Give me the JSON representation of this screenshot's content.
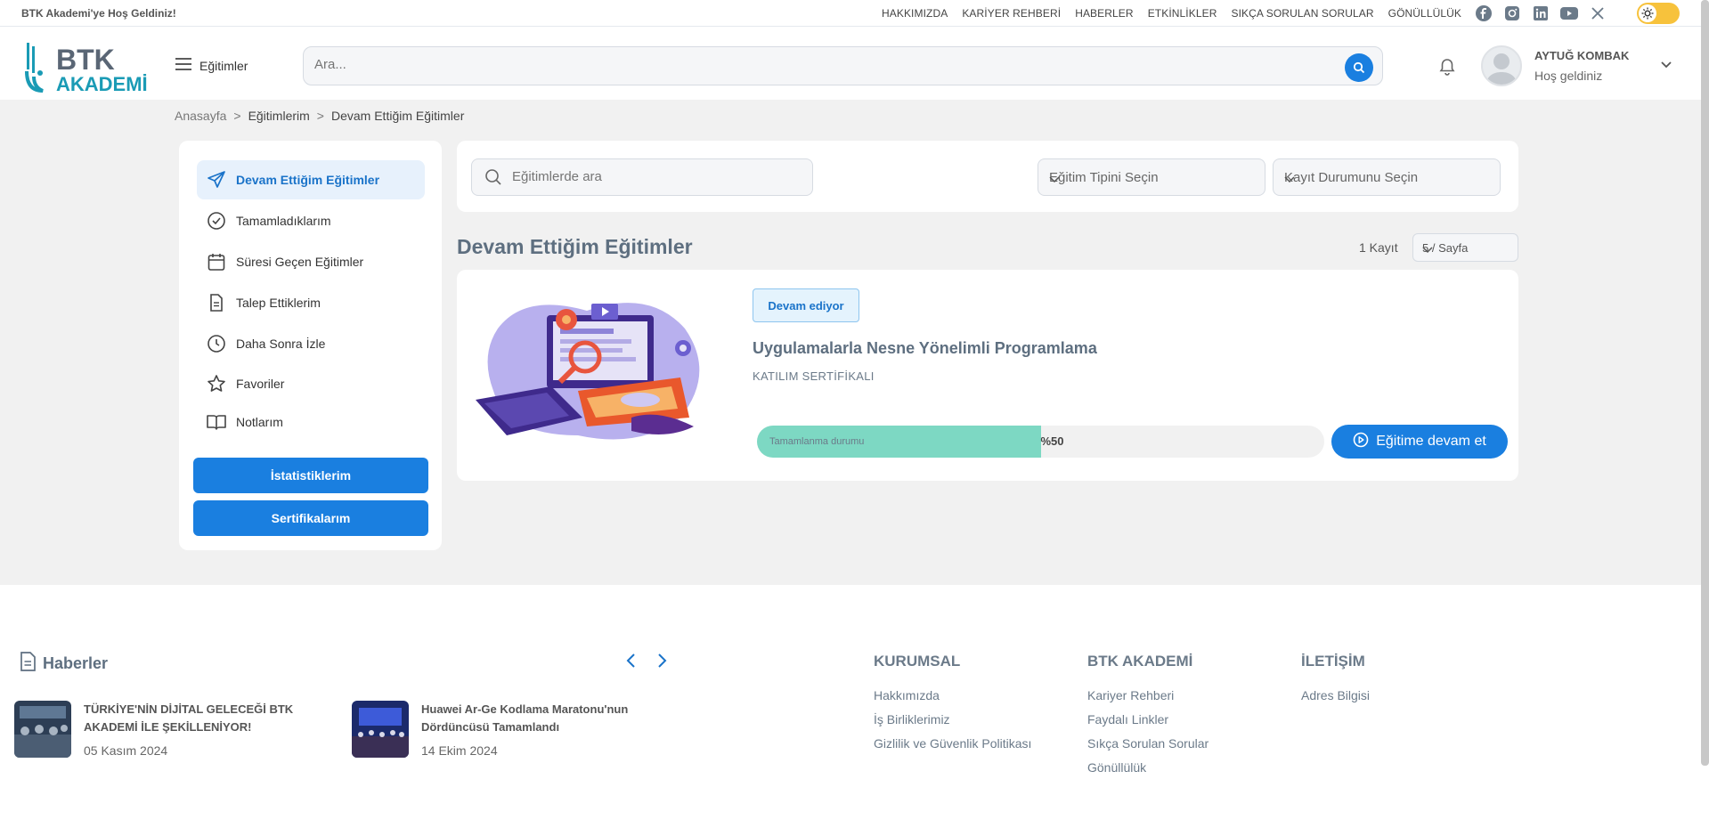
{
  "topbar": {
    "welcome": "BTK Akademi'ye Hoş Geldiniz!",
    "nav": [
      "HAKKIMIZDA",
      "KARİYER REHBERİ",
      "HABERLER",
      "ETKİNLİKLER",
      "SIKÇA SORULAN SORULAR",
      "GÖNÜLLÜLÜK"
    ],
    "socials": [
      "facebook-icon",
      "instagram-icon",
      "linkedin-icon",
      "youtube-icon",
      "x-icon"
    ]
  },
  "header": {
    "logo_top": "BTK",
    "logo_bottom": "AKADEMİ",
    "menu_label": "Eğitimler",
    "search_placeholder": "Ara...",
    "user_name": "AYTUĞ KOMBAK",
    "user_greeting": "Hoş geldiniz"
  },
  "breadcrumb": {
    "items": [
      "Anasayfa",
      "Eğitimlerim",
      "Devam Ettiğim Eğitimler"
    ],
    "separator": ">"
  },
  "sidebar": {
    "items": [
      {
        "label": "Devam Ettiğim Eğitimler",
        "icon": "send-icon",
        "active": true
      },
      {
        "label": "Tamamladıklarım",
        "icon": "check-circle-icon"
      },
      {
        "label": "Süresi Geçen Eğitimler",
        "icon": "calendar-icon"
      },
      {
        "label": "Talep Ettiklerim",
        "icon": "document-icon"
      },
      {
        "label": "Daha Sonra İzle",
        "icon": "clock-icon"
      },
      {
        "label": "Favoriler",
        "icon": "star-icon"
      },
      {
        "label": "Notlarım",
        "icon": "book-icon"
      }
    ],
    "buttons": [
      "İstatistiklerim",
      "Sertifikalarım"
    ]
  },
  "filters": {
    "search_placeholder": "Eğitimlerde ara",
    "type_select": "Eğitim Tipini Seçin",
    "status_select": "Kayıt Durumunu Seçin"
  },
  "list": {
    "title": "Devam Ettiğim Eğitimler",
    "record_count": "1 Kayıt",
    "page_size": "5 / Sayfa"
  },
  "course": {
    "status_badge": "Devam ediyor",
    "title": "Uygulamalarla Nesne Yönelimli Programlama",
    "certificate": "KATILIM SERTİFİKALI",
    "progress_label": "Tamamlanma durumu",
    "progress_text": "%50",
    "progress_value": 0.5,
    "continue_label": "Eğitime devam et"
  },
  "footer": {
    "news_heading": "Haberler",
    "news": [
      {
        "title": "TÜRKİYE'NİN DİJİTAL GELECEĞİ BTK AKADEMİ İLE ŞEKİLLENİYOR!",
        "date": "05 Kasım 2024"
      },
      {
        "title": "Huawei Ar-Ge Kodlama Maratonu'nun Dördüncüsü Tamamlandı",
        "date": "14 Ekim 2024"
      }
    ],
    "columns": [
      {
        "heading": "KURUMSAL",
        "links": [
          "Hakkımızda",
          "İş Birliklerimiz",
          "Gizlilik ve Güvenlik Politikası"
        ]
      },
      {
        "heading": "BTK AKADEMİ",
        "links": [
          "Kariyer Rehberi",
          "Faydalı Linkler",
          "Sıkça Sorulan Sorular",
          "Gönüllülük"
        ]
      },
      {
        "heading": "İLETİŞİM",
        "links": [
          "Adres Bilgisi"
        ]
      }
    ]
  },
  "colors": {
    "primary": "#1a7fe0",
    "progress_fill": "#7dd8c3",
    "page_bg": "#f1f1f1",
    "toggle": "#f7c23c"
  }
}
